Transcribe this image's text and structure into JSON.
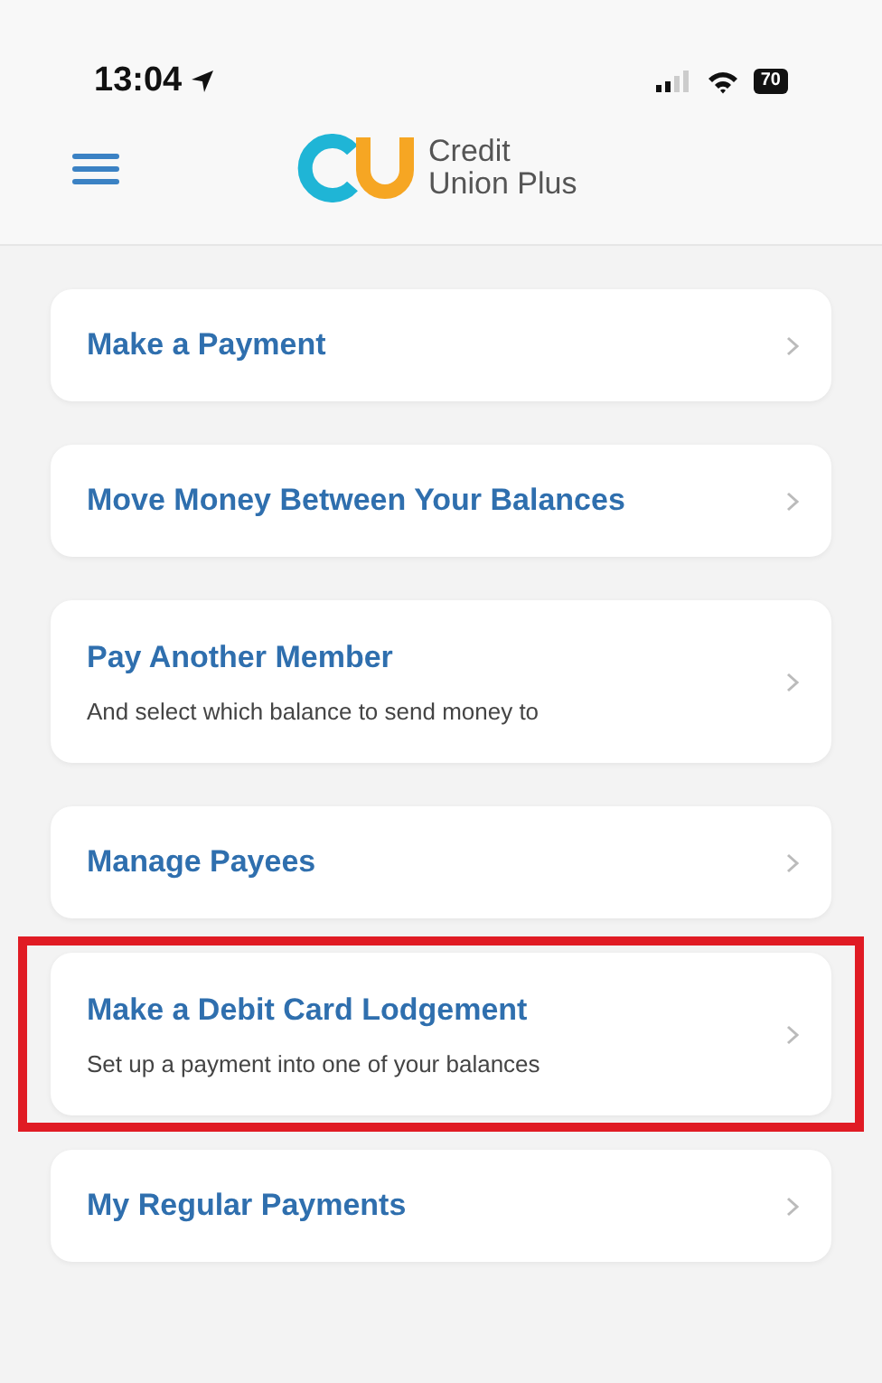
{
  "status_bar": {
    "time": "13:04",
    "battery": "70"
  },
  "header": {
    "brand_line_1": "Credit",
    "brand_line_2": "Union Plus"
  },
  "menu_items": [
    {
      "title": "Make a Payment",
      "highlighted": false
    },
    {
      "title": "Move Money Between Your Balances",
      "highlighted": false
    },
    {
      "title": "Pay Another Member",
      "subtitle": "And select which balance to send money to",
      "highlighted": false
    },
    {
      "title": "Manage Payees",
      "highlighted": false
    },
    {
      "title": "Make a Debit Card Lodgement",
      "subtitle": "Set up a payment into one of your balances",
      "highlighted": true
    },
    {
      "title": "My Regular Payments",
      "highlighted": false
    }
  ]
}
